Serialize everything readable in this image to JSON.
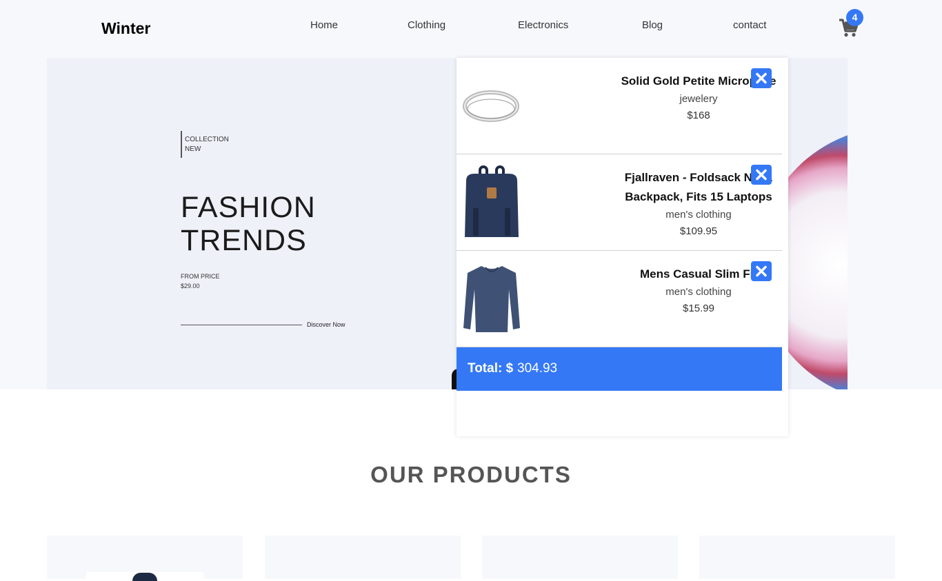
{
  "header": {
    "logo": "Winter",
    "nav": [
      "Home",
      "Clothing",
      "Electronics",
      "Blog",
      "contact"
    ],
    "cart_count": "4"
  },
  "hero": {
    "collection_line1": "COLLECTION",
    "collection_line2": "NEW",
    "title_line1": "FASHION",
    "title_line2": "TRENDS",
    "from_price_label": "FROM PRICE",
    "from_price_value": "$29.00",
    "discover": "Discover Now"
  },
  "cart": {
    "items": [
      {
        "name": "Solid Gold Petite Micropave",
        "category": "jewelery",
        "price": "$168",
        "image": "ring-image"
      },
      {
        "name": "Fjallraven - Foldsack No. 1 Backpack, Fits 15 Laptops",
        "category": "men's clothing",
        "price": "$109.95",
        "image": "backpack-image"
      },
      {
        "name": "Mens Casual Slim Fit",
        "category": "men's clothing",
        "price": "$15.99",
        "image": "tshirt-image"
      }
    ],
    "total_label": "Total: $",
    "total_value": "304.93"
  },
  "products": {
    "title": "OUR PRODUCTS"
  },
  "colors": {
    "accent": "#3478f6",
    "header_bg": "#f7f8fc",
    "hero_bg": "#eef1f8"
  }
}
